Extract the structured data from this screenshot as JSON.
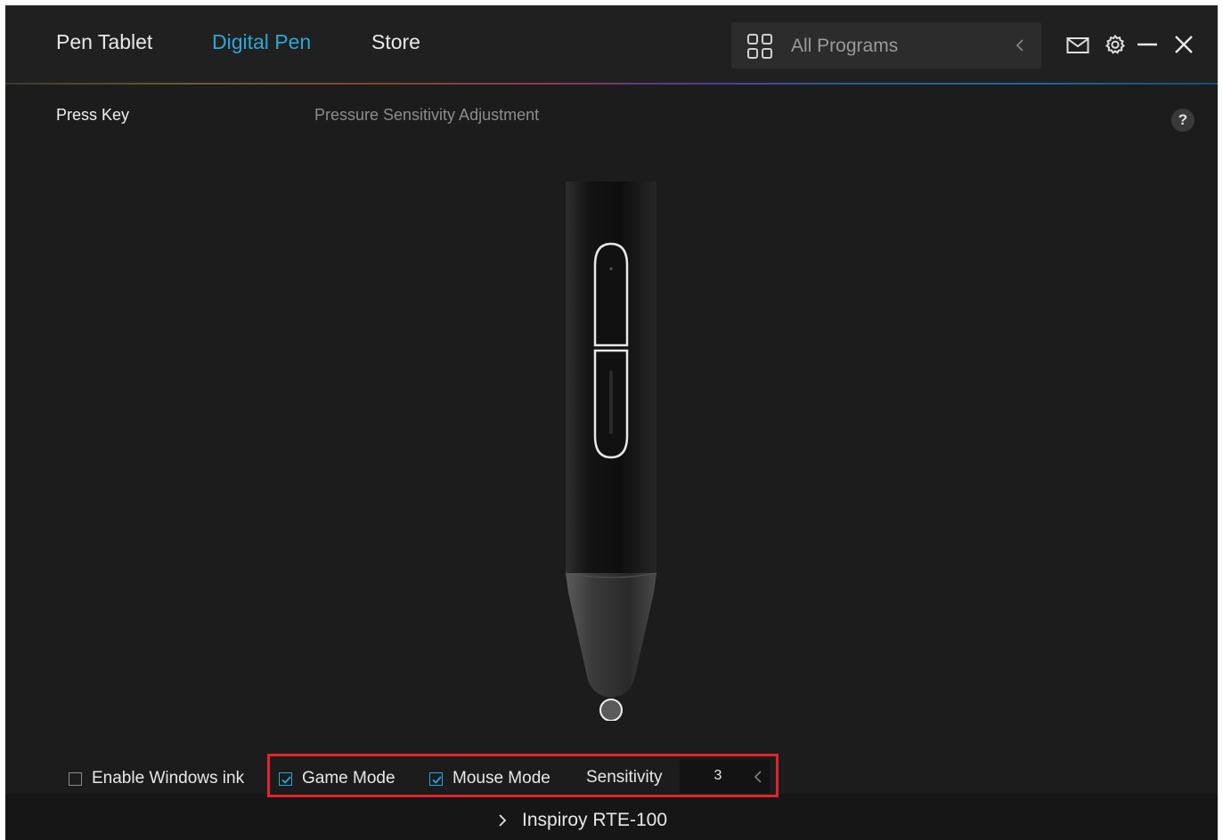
{
  "header": {
    "tabs": [
      {
        "label": "Pen Tablet",
        "active": false
      },
      {
        "label": "Digital Pen",
        "active": true
      },
      {
        "label": "Store",
        "active": false
      }
    ],
    "program_selector": {
      "value": "All Programs",
      "icon": "grid-icon"
    },
    "window_icons": [
      "mail-icon",
      "gear-icon",
      "minimize-icon",
      "close-icon"
    ]
  },
  "subtabs": [
    {
      "label": "Press Key",
      "active": true
    },
    {
      "label": "Pressure Sensitivity Adjustment",
      "active": false
    }
  ],
  "help": {
    "label": "?"
  },
  "options": {
    "windows_ink": {
      "label": "Enable Windows ink",
      "checked": false
    },
    "game_mode": {
      "label": "Game Mode",
      "checked": true
    },
    "mouse_mode": {
      "label": "Mouse Mode",
      "checked": true
    },
    "sensitivity": {
      "label": "Sensitivity",
      "value": "3"
    }
  },
  "footer": {
    "device": "Inspiroy RTE-100"
  },
  "colors": {
    "accent": "#29a8d6",
    "background": "#1c1c1c",
    "highlight": "#e2242b"
  }
}
